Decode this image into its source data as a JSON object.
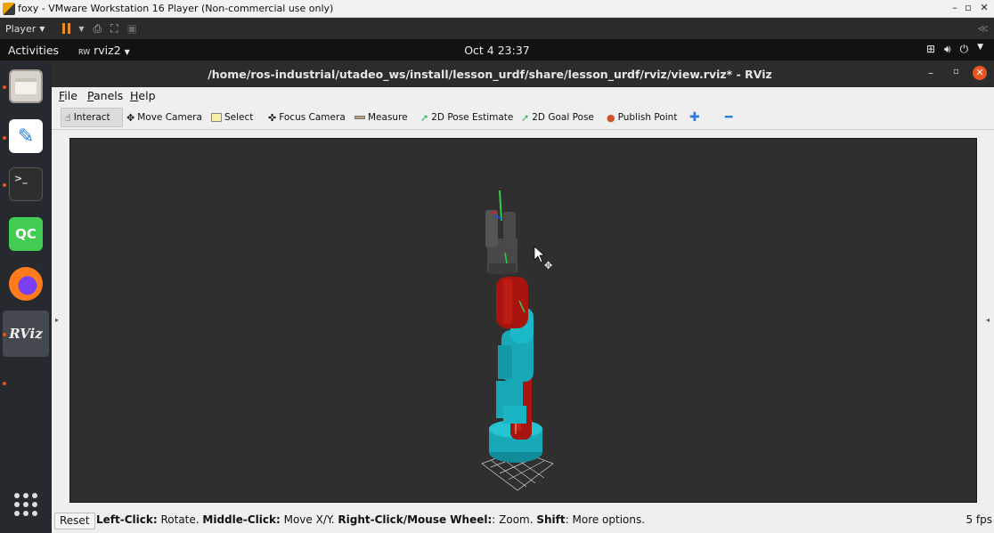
{
  "vm": {
    "title": "foxy - VMware Workstation 16 Player (Non-commercial use only)",
    "player_label": "Player"
  },
  "gnome": {
    "activities": "Activities",
    "app_name": "rviz2",
    "clock": "Oct 4  23:37"
  },
  "dock": {
    "items": [
      {
        "name": "files",
        "label": ""
      },
      {
        "name": "text-editor",
        "label": ""
      },
      {
        "name": "terminal",
        "label": ">_"
      },
      {
        "name": "qtcreator",
        "label": "QC"
      },
      {
        "name": "firefox",
        "label": ""
      },
      {
        "name": "rviz",
        "label": "RViz"
      }
    ]
  },
  "rviz": {
    "window_title": "/home/ros-industrial/utadeo_ws/install/lesson_urdf/share/lesson_urdf/rviz/view.rviz* - RViz",
    "menu": {
      "file_first": "F",
      "file_rest": "ile",
      "panels_first": "P",
      "panels_rest": "anels",
      "help_first": "H",
      "help_rest": "elp"
    },
    "toolbar": {
      "interact": "Interact",
      "move_camera": "Move Camera",
      "select": "Select",
      "focus_camera": "Focus Camera",
      "measure": "Measure",
      "pose_estimate": "2D Pose Estimate",
      "goal_pose": "2D Goal Pose",
      "publish_point": "Publish Point"
    },
    "status": {
      "reset": "Reset",
      "hint_b1": "Left-Click:",
      "hint_t1": " Rotate. ",
      "hint_b2": "Middle-Click:",
      "hint_t2": " Move X/Y. ",
      "hint_b3": "Right-Click/Mouse Wheel:",
      "hint_t3": ": Zoom. ",
      "hint_b4": "Shift",
      "hint_t4": ": More options.",
      "fps": "5 fps"
    },
    "colors": {
      "link_cyan": "#17a9b8",
      "link_red": "#a8140f",
      "link_gray": "#4a4a4a",
      "viewport_bg": "#2f2f2f",
      "accent_orange": "#e95420"
    }
  }
}
